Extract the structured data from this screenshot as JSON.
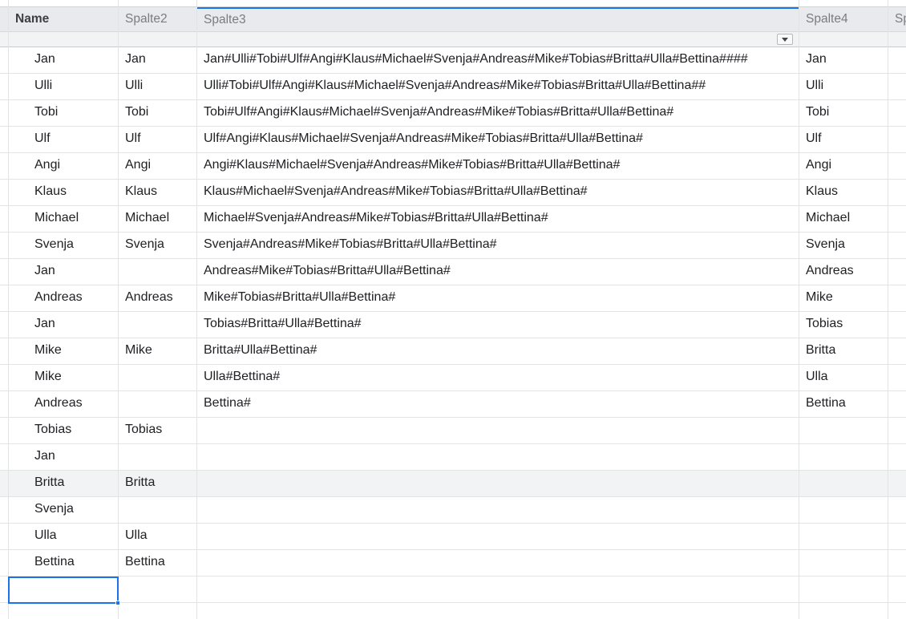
{
  "columns": {
    "name": "Name",
    "spalte2": "Spalte2",
    "spalte3": "Spalte3",
    "spalte4": "Spalte4",
    "spalte5_partial": "Sp"
  },
  "rows": [
    {
      "name": "Jan",
      "spalte2": "Jan",
      "spalte3": "Jan#Ulli#Tobi#Ulf#Angi#Klaus#Michael#Svenja#Andreas#Mike#Tobias#Britta#Ulla#Bettina####",
      "spalte4": "Jan"
    },
    {
      "name": "Ulli",
      "spalte2": "Ulli",
      "spalte3": "Ulli#Tobi#Ulf#Angi#Klaus#Michael#Svenja#Andreas#Mike#Tobias#Britta#Ulla#Bettina##",
      "spalte4": "Ulli"
    },
    {
      "name": "Tobi",
      "spalte2": "Tobi",
      "spalte3": "Tobi#Ulf#Angi#Klaus#Michael#Svenja#Andreas#Mike#Tobias#Britta#Ulla#Bettina#",
      "spalte4": "Tobi"
    },
    {
      "name": "Ulf",
      "spalte2": "Ulf",
      "spalte3": "Ulf#Angi#Klaus#Michael#Svenja#Andreas#Mike#Tobias#Britta#Ulla#Bettina#",
      "spalte4": "Ulf"
    },
    {
      "name": "Angi",
      "spalte2": "Angi",
      "spalte3": "Angi#Klaus#Michael#Svenja#Andreas#Mike#Tobias#Britta#Ulla#Bettina#",
      "spalte4": "Angi"
    },
    {
      "name": "Klaus",
      "spalte2": "Klaus",
      "spalte3": "Klaus#Michael#Svenja#Andreas#Mike#Tobias#Britta#Ulla#Bettina#",
      "spalte4": "Klaus"
    },
    {
      "name": "Michael",
      "spalte2": "Michael",
      "spalte3": "Michael#Svenja#Andreas#Mike#Tobias#Britta#Ulla#Bettina#",
      "spalte4": "Michael"
    },
    {
      "name": "Svenja",
      "spalte2": "Svenja",
      "spalte3": "Svenja#Andreas#Mike#Tobias#Britta#Ulla#Bettina#",
      "spalte4": "Svenja"
    },
    {
      "name": "Jan",
      "spalte2": "",
      "spalte3": "Andreas#Mike#Tobias#Britta#Ulla#Bettina#",
      "spalte4": "Andreas"
    },
    {
      "name": "Andreas",
      "spalte2": "Andreas",
      "spalte3": "Mike#Tobias#Britta#Ulla#Bettina#",
      "spalte4": "Mike"
    },
    {
      "name": "Jan",
      "spalte2": "",
      "spalte3": "Tobias#Britta#Ulla#Bettina#",
      "spalte4": "Tobias"
    },
    {
      "name": "Mike",
      "spalte2": "Mike",
      "spalte3": "Britta#Ulla#Bettina#",
      "spalte4": "Britta"
    },
    {
      "name": "Mike",
      "spalte2": "",
      "spalte3": "Ulla#Bettina#",
      "spalte4": "Ulla"
    },
    {
      "name": "Andreas",
      "spalte2": "",
      "spalte3": "Bettina#",
      "spalte4": "Bettina"
    },
    {
      "name": "Tobias",
      "spalte2": "Tobias",
      "spalte3": "",
      "spalte4": ""
    },
    {
      "name": "Jan",
      "spalte2": "",
      "spalte3": "",
      "spalte4": ""
    },
    {
      "name": "Britta",
      "spalte2": "Britta",
      "spalte3": "",
      "spalte4": ""
    },
    {
      "name": "Svenja",
      "spalte2": "",
      "spalte3": "",
      "spalte4": ""
    },
    {
      "name": "Ulla",
      "spalte2": "Ulla",
      "spalte3": "",
      "spalte4": ""
    },
    {
      "name": "Bettina",
      "spalte2": "Bettina",
      "spalte3": "",
      "spalte4": ""
    },
    {
      "name": "",
      "spalte2": "",
      "spalte3": "",
      "spalte4": ""
    }
  ],
  "highlighted_row_index": 16,
  "selected_cell": {
    "row": 20,
    "column": "Name"
  }
}
